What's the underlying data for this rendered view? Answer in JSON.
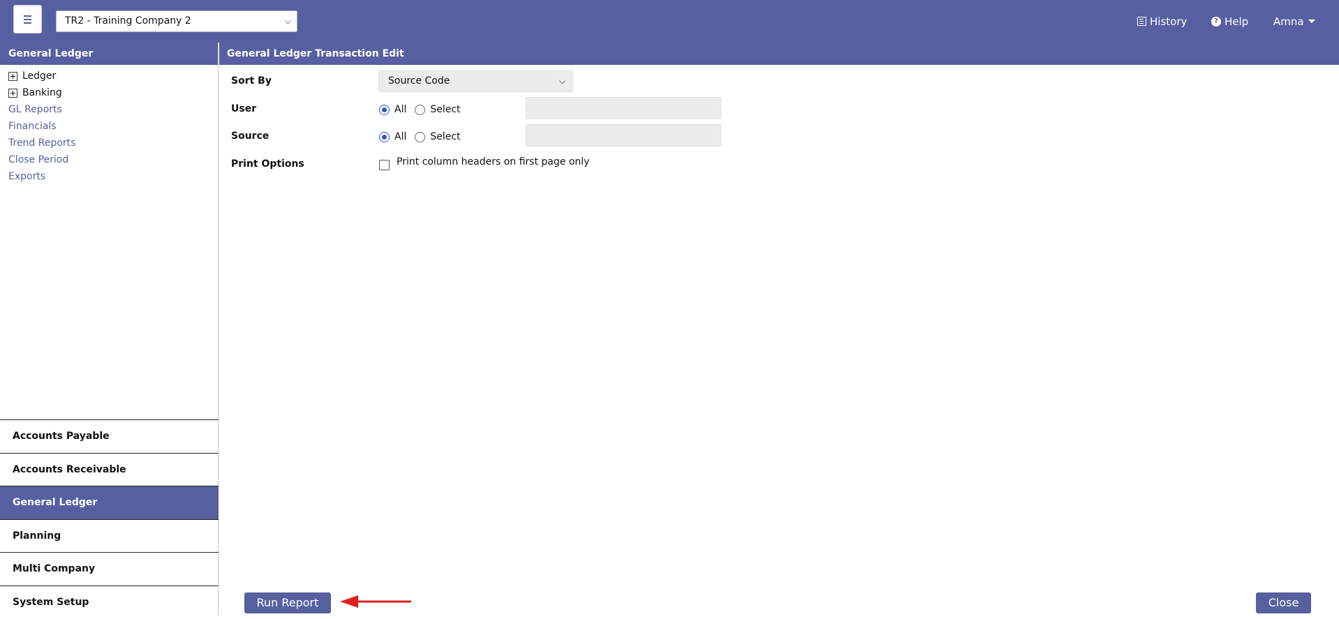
{
  "topbar": {
    "company": "TR2 - Training Company 2",
    "history_label": "History",
    "help_label": "Help",
    "user_label": "Amna"
  },
  "sidebar": {
    "title": "General Ledger",
    "tree": [
      {
        "label": "Ledger",
        "expandable": true
      },
      {
        "label": "Banking",
        "expandable": true
      },
      {
        "label": "GL Reports"
      },
      {
        "label": "Financials"
      },
      {
        "label": "Trend Reports"
      },
      {
        "label": "Close Period"
      },
      {
        "label": "Exports"
      }
    ],
    "modules": [
      {
        "label": "Accounts Payable"
      },
      {
        "label": "Accounts Receivable"
      },
      {
        "label": "General Ledger",
        "active": true
      },
      {
        "label": "Planning"
      },
      {
        "label": "Multi Company"
      },
      {
        "label": "System Setup"
      }
    ]
  },
  "main": {
    "title": "General Ledger Transaction Edit",
    "sort_by_label": "Sort By",
    "sort_by_value": "Source Code",
    "user_label": "User",
    "user_all": "All",
    "user_select": "Select",
    "source_label": "Source",
    "source_all": "All",
    "source_select": "Select",
    "print_options_label": "Print Options",
    "print_option_text": "Print column headers on first page only",
    "run_report_label": "Run Report",
    "close_label": "Close"
  },
  "colors": {
    "brand": "#5660a0",
    "annotation_arrow": "#e02020"
  }
}
